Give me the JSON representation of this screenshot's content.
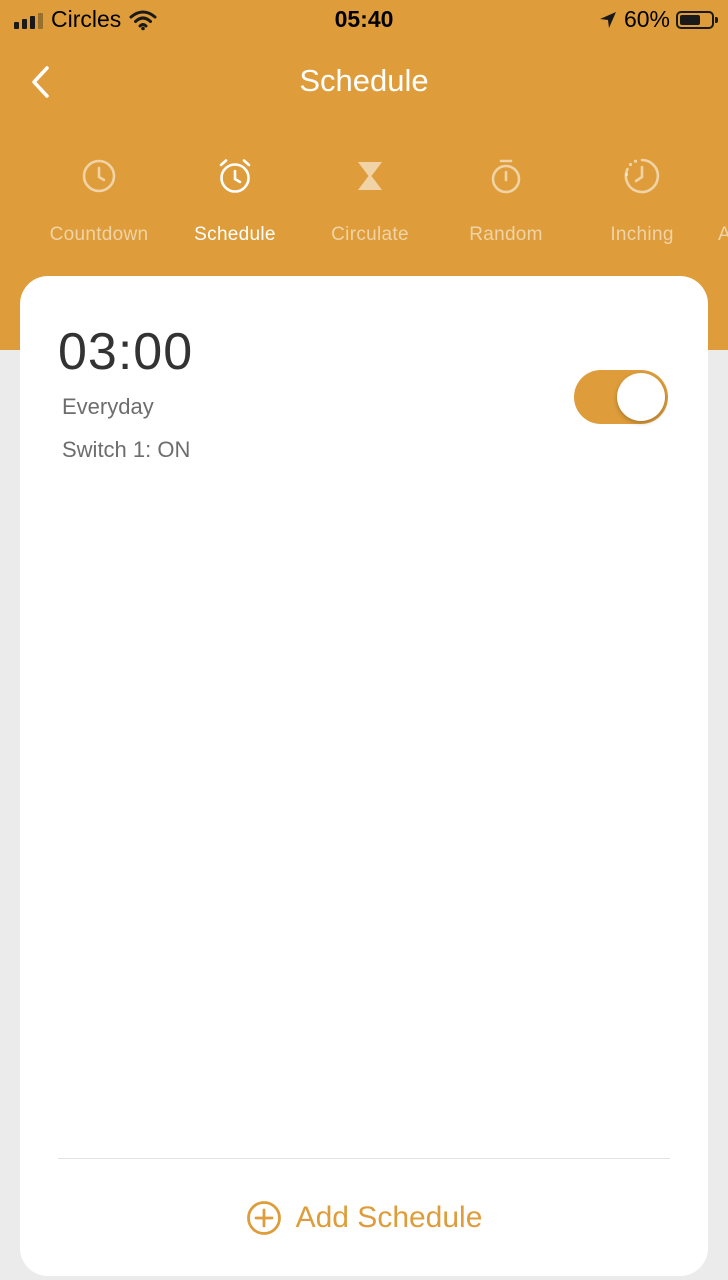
{
  "status_bar": {
    "carrier": "Circles",
    "time": "05:40",
    "battery": "60%",
    "icons": [
      "signal-icon",
      "wifi-icon",
      "location-arrow-icon",
      "battery-icon"
    ]
  },
  "nav": {
    "title": "Schedule",
    "back_icon": "chevron-left-icon"
  },
  "tabs": [
    {
      "label": "Countdown",
      "icon": "clock-icon",
      "active": false
    },
    {
      "label": "Schedule",
      "icon": "alarm-clock-icon",
      "active": true
    },
    {
      "label": "Circulate",
      "icon": "hourglass-icon",
      "active": false
    },
    {
      "label": "Random",
      "icon": "stopwatch-icon",
      "active": false
    },
    {
      "label": "Inching",
      "icon": "dotted-clock-icon",
      "active": false
    },
    {
      "label": "A",
      "icon": "",
      "active": false
    }
  ],
  "schedules": [
    {
      "time": "03:00",
      "repeat": "Everyday",
      "action": "Switch 1: ON",
      "enabled": true
    }
  ],
  "add_button": {
    "label": "Add Schedule",
    "icon": "plus-circle-icon"
  },
  "colors": {
    "accent": "#de9d3a",
    "background": "#ebebeb",
    "card": "#ffffff",
    "text_primary": "#333333",
    "text_secondary": "#6d6d6d"
  }
}
